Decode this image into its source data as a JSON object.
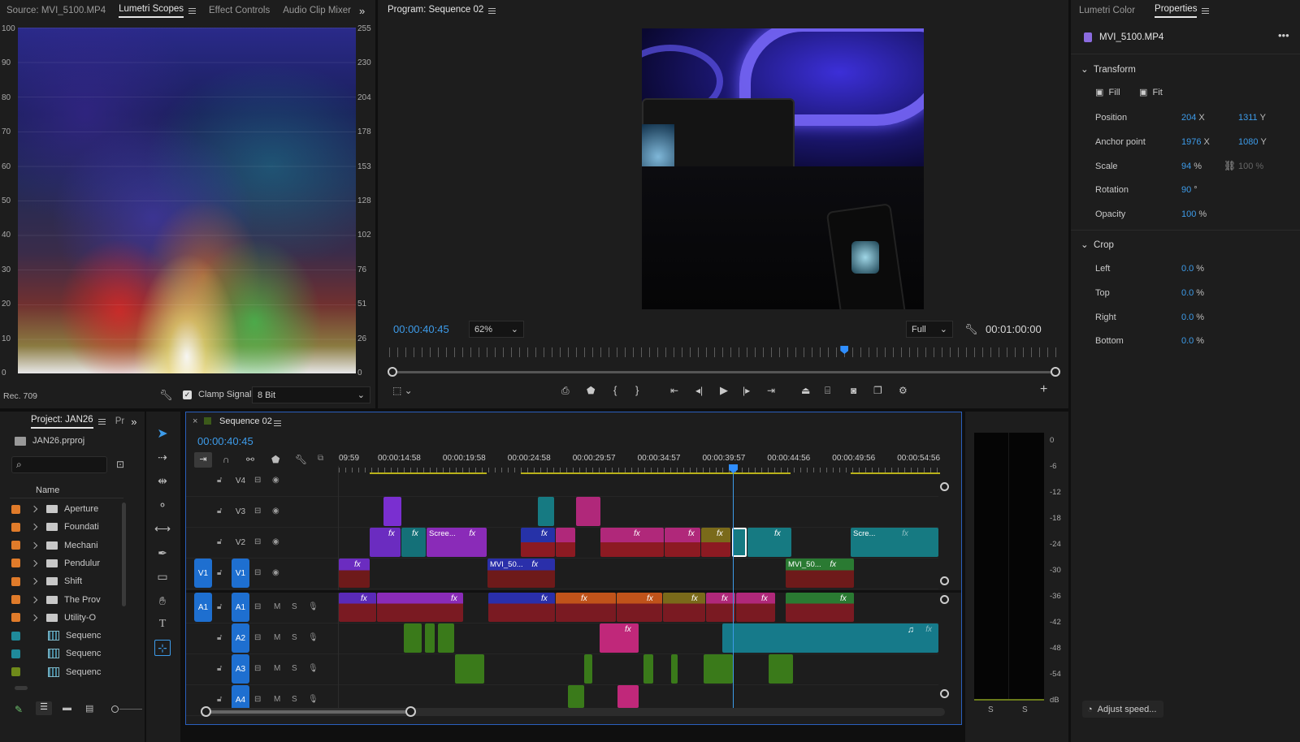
{
  "source_panel": {
    "tabs": [
      {
        "label": "Source: MVI_5100.MP4"
      },
      {
        "label": "Lumetri Scopes",
        "active": true
      },
      {
        "label": "Effect Controls"
      },
      {
        "label": "Audio Clip Mixer"
      }
    ],
    "left_axis": [
      "100",
      "90",
      "80",
      "70",
      "60",
      "50",
      "40",
      "30",
      "20",
      "10",
      "0"
    ],
    "right_axis": [
      "255",
      "230",
      "204",
      "178",
      "153",
      "128",
      "102",
      "76",
      "51",
      "26",
      "0"
    ],
    "colorspace": "Rec. 709",
    "clamp_label": "Clamp Signal",
    "bit_depth": "8 Bit"
  },
  "program_panel": {
    "title": "Program: Sequence 02",
    "timecode": "00:00:40:45",
    "zoom": "62%",
    "quality": "Full",
    "duration": "00:01:00:00",
    "playhead_fraction": 0.68
  },
  "properties_panel": {
    "tabs": [
      {
        "label": "Lumetri Color"
      },
      {
        "label": "Properties",
        "active": true
      }
    ],
    "clip_name": "MVI_5100.MP4",
    "transform_title": "Transform",
    "fill_label": "Fill",
    "fit_label": "Fit",
    "position": {
      "label": "Position",
      "x": "204",
      "x_unit": "X",
      "y": "1311",
      "y_unit": "Y"
    },
    "anchor": {
      "label": "Anchor point",
      "x": "1976",
      "x_unit": "X",
      "y": "1080",
      "y_unit": "Y"
    },
    "scale": {
      "label": "Scale",
      "value": "94",
      "unit": "%",
      "linked": "100 %"
    },
    "rotation": {
      "label": "Rotation",
      "value": "90",
      "unit": "°"
    },
    "opacity": {
      "label": "Opacity",
      "value": "100",
      "unit": "%"
    },
    "crop_title": "Crop",
    "crop": [
      {
        "label": "Left",
        "value": "0.0",
        "unit": "%"
      },
      {
        "label": "Top",
        "value": "0.0",
        "unit": "%"
      },
      {
        "label": "Right",
        "value": "0.0",
        "unit": "%"
      },
      {
        "label": "Bottom",
        "value": "0.0",
        "unit": "%"
      }
    ],
    "adjust_speed": "Adjust speed..."
  },
  "project_panel": {
    "tab": "Project: JAN26",
    "tab2": "Pr",
    "file": "JAN26.prproj",
    "column": "Name",
    "items": [
      {
        "label": "Aperture",
        "color": "#e07b2a",
        "kind": "folder"
      },
      {
        "label": "Foundati",
        "color": "#e07b2a",
        "kind": "folder"
      },
      {
        "label": "Mechani",
        "color": "#e07b2a",
        "kind": "folder"
      },
      {
        "label": "Pendulur",
        "color": "#e07b2a",
        "kind": "folder"
      },
      {
        "label": "Shift",
        "color": "#e07b2a",
        "kind": "folder"
      },
      {
        "label": "The Prov",
        "color": "#e07b2a",
        "kind": "folder"
      },
      {
        "label": "Utility-O",
        "color": "#e07b2a",
        "kind": "folder"
      },
      {
        "label": "Sequenc",
        "color": "#1f8a9a",
        "kind": "sequence"
      },
      {
        "label": "Sequenc",
        "color": "#1f8a9a",
        "kind": "sequence"
      },
      {
        "label": "Sequenc",
        "color": "#6f8a1a",
        "kind": "sequence"
      }
    ]
  },
  "timeline": {
    "title": "Sequence 02",
    "timecode": "00:00:40:45",
    "ruler": [
      "09:59",
      "00:00:14:58",
      "00:00:19:58",
      "00:00:24:58",
      "00:00:29:57",
      "00:00:34:57",
      "00:00:39:57",
      "00:00:44:56",
      "00:00:49:56",
      "00:00:54:56"
    ],
    "video_tracks": [
      "V4",
      "V3",
      "V2",
      "V1"
    ],
    "audio_tracks": [
      "A1",
      "A2",
      "A3",
      "A4"
    ],
    "source_v": "V1",
    "source_a": "A1",
    "mute": "M",
    "solo": "S",
    "clip_labels": {
      "scree1": "Scree...",
      "scree2": "Scre...",
      "mvi1": "MVI_50...",
      "mvi2": "MVI_50..."
    },
    "fx": "fx"
  },
  "meter": {
    "scale": [
      "0",
      "-6",
      "-12",
      "-18",
      "-24",
      "-30",
      "-36",
      "-42",
      "-48",
      "-54",
      "dB"
    ],
    "channels": [
      "S",
      "S"
    ]
  }
}
